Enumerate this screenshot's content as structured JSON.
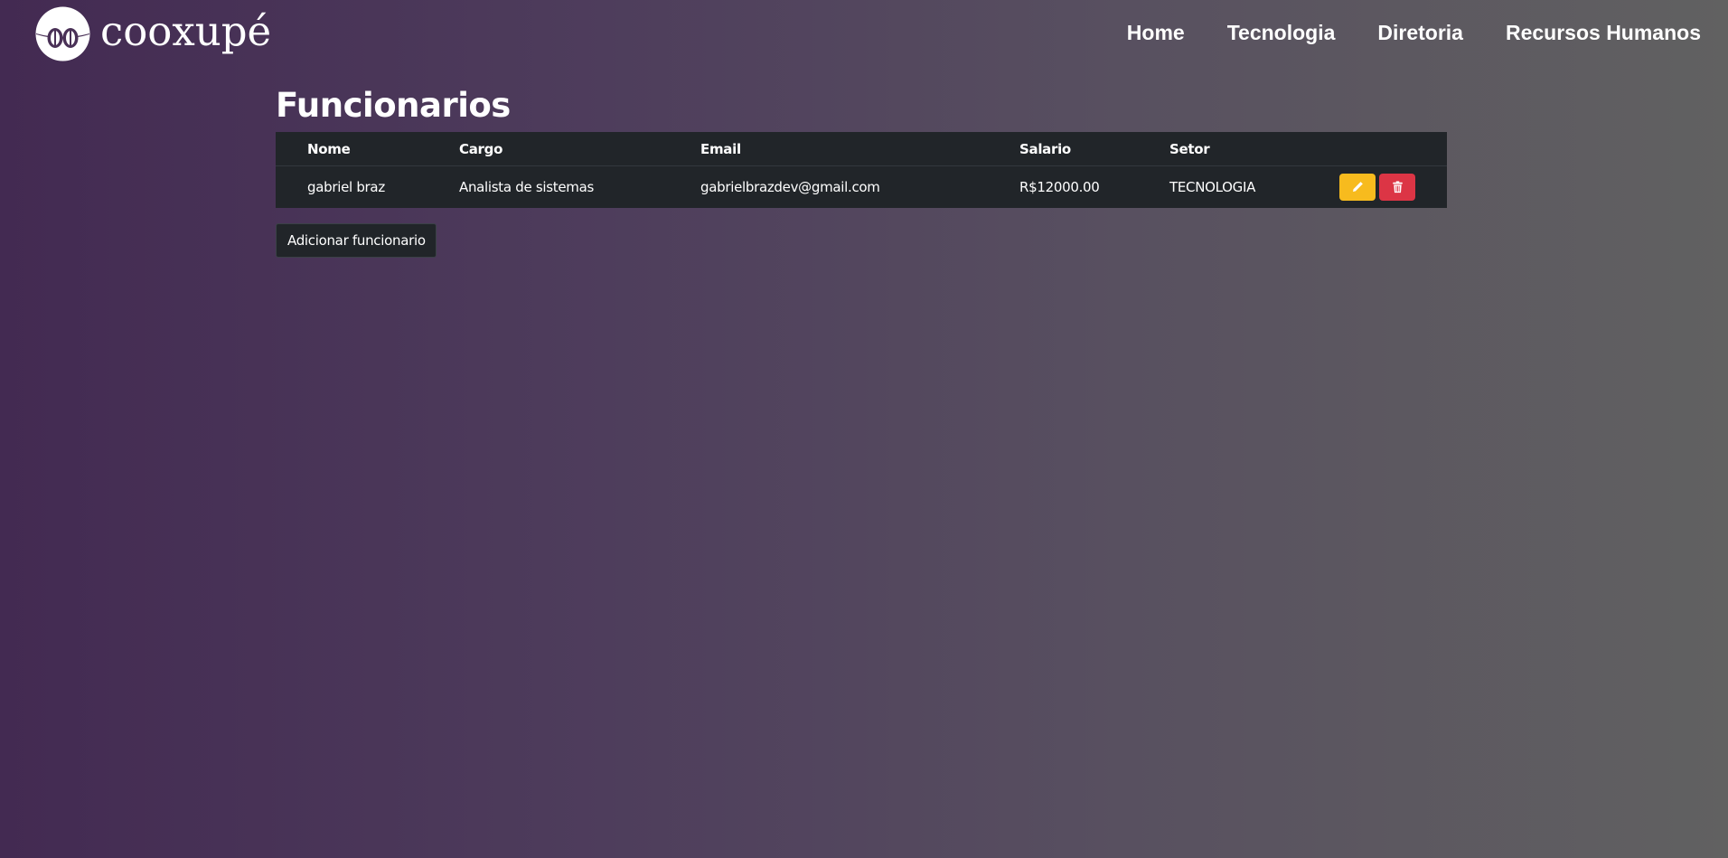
{
  "brand": {
    "name": "cooxupé",
    "logo_icon": "cooxupe-logo-icon"
  },
  "nav": {
    "items": [
      {
        "label": "Home"
      },
      {
        "label": "Tecnologia"
      },
      {
        "label": "Diretoria"
      },
      {
        "label": "Recursos Humanos"
      }
    ]
  },
  "main": {
    "title": "Funcionarios",
    "table": {
      "headers": [
        "Nome",
        "Cargo",
        "Email",
        "Salario",
        "Setor"
      ],
      "rows": [
        {
          "nome": "gabriel braz",
          "cargo": "Analista de sistemas",
          "email": "gabrielbrazdev@gmail.com",
          "salario": "R$12000.00",
          "setor": "TECNOLOGIA",
          "edit_icon": "pencil-icon",
          "delete_icon": "trash-icon"
        }
      ]
    },
    "add_button_label": "Adicionar funcionario"
  },
  "colors": {
    "table_bg": "#212529",
    "edit_button": "#f7bb1e",
    "delete_button": "#dc3545",
    "gradient_start": "#432a52",
    "gradient_end": "#616161"
  }
}
